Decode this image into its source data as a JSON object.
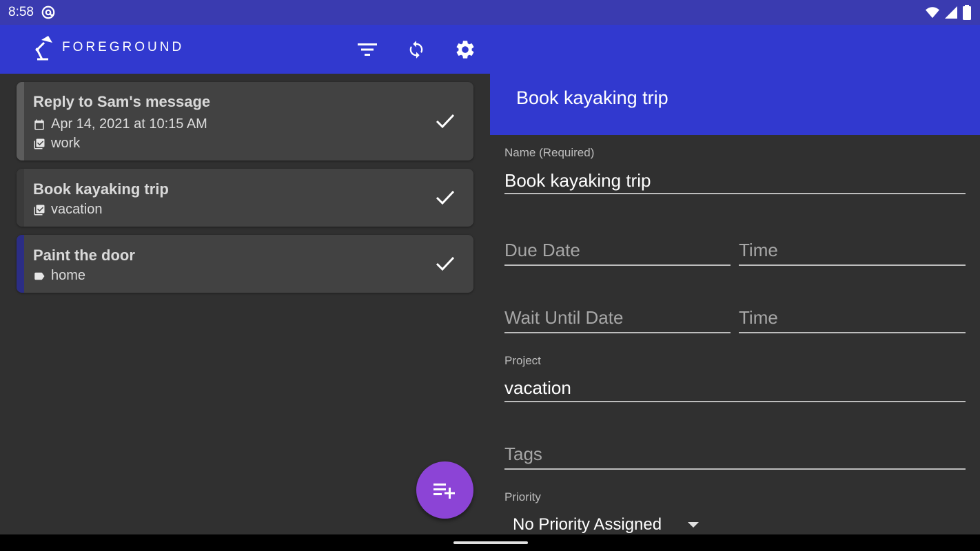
{
  "status_bar": {
    "time": "8:58",
    "icons": [
      "at-sign-icon",
      "wifi-icon",
      "signal-icon",
      "battery-icon"
    ]
  },
  "app_bar": {
    "logo_text": "FOREGROUND",
    "actions": [
      "filter-icon",
      "sync-icon",
      "settings-icon"
    ]
  },
  "tasks": [
    {
      "title": "Reply to Sam's message",
      "date": "Apr 14, 2021 at 10:15 AM",
      "project": "work",
      "bar_color": "#5c5c5c"
    },
    {
      "title": "Book kayaking trip",
      "project": "vacation",
      "bar_color": "#3a3a3a"
    },
    {
      "title": "Paint the door",
      "tag": "home",
      "bar_color": "#2b2d85"
    }
  ],
  "detail": {
    "header_title": "Book kayaking trip",
    "name_label": "Name (Required)",
    "name_value": "Book kayaking trip",
    "due_date_placeholder": "Due Date",
    "due_time_placeholder": "Time",
    "wait_date_placeholder": "Wait Until Date",
    "wait_time_placeholder": "Time",
    "project_label": "Project",
    "project_value": "vacation",
    "tags_placeholder": "Tags",
    "priority_label": "Priority",
    "priority_value": "No Priority Assigned"
  },
  "colors": {
    "primary": "#3139cf",
    "status_bar": "#3a3bb0",
    "fab": "#8c44d6",
    "background": "#303030",
    "card": "#424242"
  }
}
